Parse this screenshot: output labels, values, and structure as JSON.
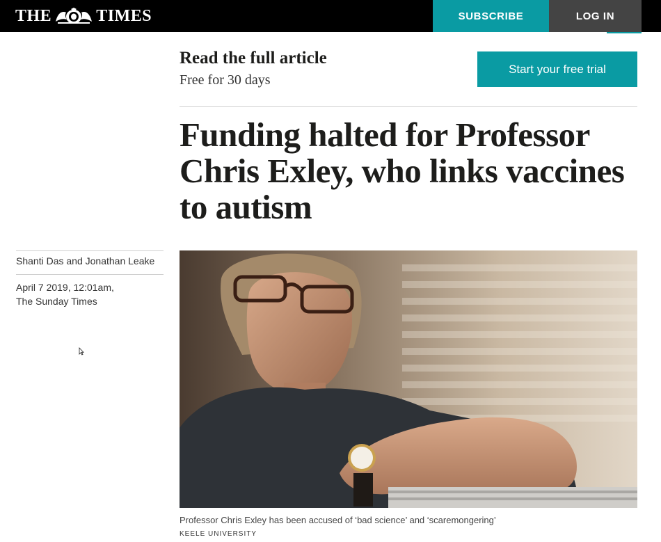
{
  "header": {
    "logo_left": "THE",
    "logo_right": "TIMES",
    "subscribe_label": "SUBSCRIBE",
    "login_label": "LOG IN",
    "colors": {
      "bar": "#000000",
      "accent": "#0a9ba3",
      "login_bg": "#444444"
    }
  },
  "promo": {
    "title": "Read the full article",
    "subtitle": "Free for 30 days",
    "trial_label": "Start your free trial"
  },
  "article": {
    "headline": "Funding halted for Professor Chris Exley, who links vaccines to autism",
    "authors": "Shanti Das and Jonathan Leake",
    "date": "April 7 2019, 12:01am,",
    "publication": "The Sunday Times",
    "caption": "Professor Chris Exley has been accused of ‘bad science’ and ‘scaremongering’",
    "credit": "KEELE UNIVERSITY"
  },
  "icons": {
    "crest": "royal-crest-icon",
    "cursor": "mouse-pointer-icon"
  }
}
